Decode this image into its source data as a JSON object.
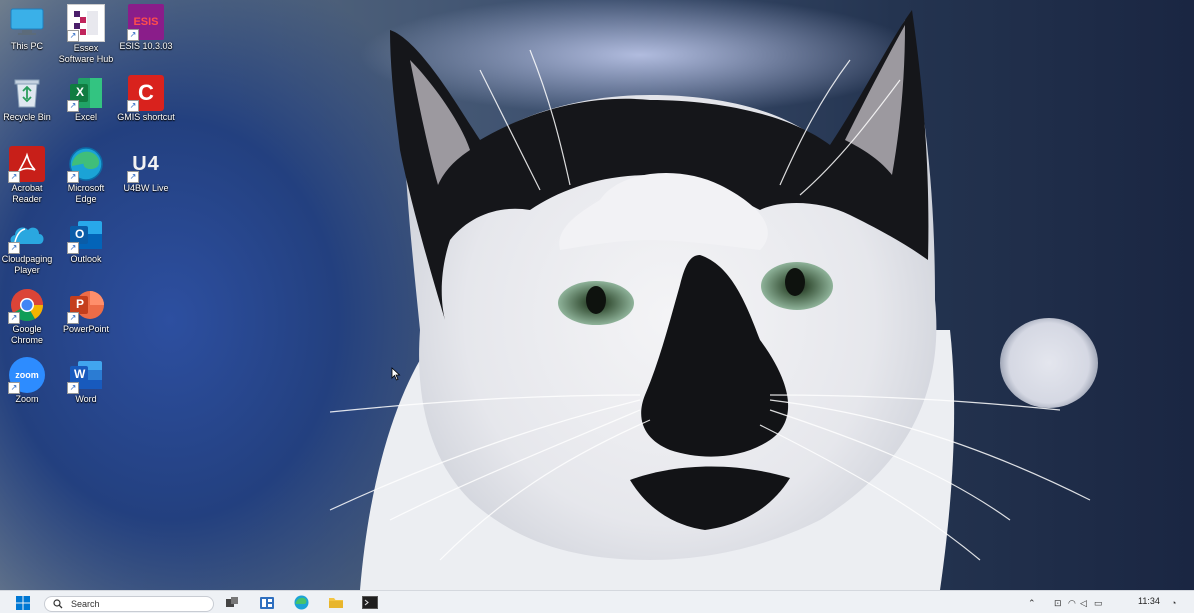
{
  "desktop": {
    "icons": [
      {
        "label": "This PC",
        "icon": "this-pc-icon"
      },
      {
        "label": "Essex\nSoftware Hub",
        "icon": "essex-software-hub-icon"
      },
      {
        "label": "ESIS 10.3.03",
        "icon": "esis-icon",
        "glyph_text": "ESIS"
      },
      {
        "label": "Recycle Bin",
        "icon": "recycle-bin-icon"
      },
      {
        "label": "Excel",
        "icon": "excel-icon",
        "glyph_text": "X"
      },
      {
        "label": "GMIS shortcut",
        "icon": "gmis-icon",
        "glyph_text": "C"
      },
      {
        "label": "Acrobat\nReader",
        "icon": "acrobat-reader-icon"
      },
      {
        "label": "Microsoft\nEdge",
        "icon": "edge-icon"
      },
      {
        "label": "U4BW Live",
        "icon": "u4bw-icon",
        "glyph_text": "U4"
      },
      {
        "label": "Cloudpaging\nPlayer",
        "icon": "cloudpaging-icon"
      },
      {
        "label": "Outlook",
        "icon": "outlook-icon",
        "glyph_text": "O"
      },
      {
        "label": "Google\nChrome",
        "icon": "chrome-icon"
      },
      {
        "label": "PowerPoint",
        "icon": "powerpoint-icon",
        "glyph_text": "P"
      },
      {
        "label": "Zoom",
        "icon": "zoom-icon",
        "glyph_text": "zoom"
      },
      {
        "label": "Word",
        "icon": "word-icon",
        "glyph_text": "W"
      }
    ]
  },
  "taskbar": {
    "search_placeholder": "Search",
    "clock_time": "11:34"
  },
  "colors": {
    "taskbar_bg": "#eef1f5",
    "accent": "#0078d4"
  }
}
